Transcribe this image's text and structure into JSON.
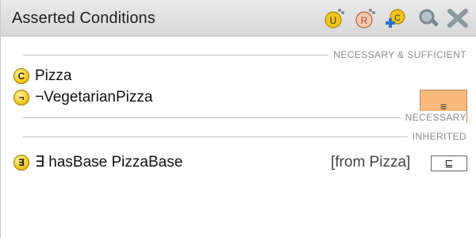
{
  "header": {
    "title": "Asserted Conditions",
    "toolbar": [
      {
        "name": "create-condition-icon"
      },
      {
        "name": "create-restriction-icon"
      },
      {
        "name": "add-named-class-icon"
      },
      {
        "name": "find-usage-icon"
      },
      {
        "name": "delete-condition-icon"
      }
    ]
  },
  "sections": {
    "necessary_sufficient": "NECESSARY & SUFFICIENT",
    "necessary": "NECESSARY",
    "inherited": "INHERITED"
  },
  "conditions": {
    "pizza": {
      "badge": "C",
      "text": "Pizza"
    },
    "not_vegetarian": {
      "badge": "¬",
      "text": "¬VegetarianPizza"
    },
    "has_base": {
      "badge": "∃",
      "text": "∃ hasBase PizzaBase",
      "source": "[from Pizza]"
    }
  },
  "buttons": {
    "equivalent_symbol": "≡",
    "subclass_symbol": "⊑"
  },
  "colors": {
    "nec_suff_button": "#f9b97b",
    "badge_yellow": "#f3c823"
  }
}
